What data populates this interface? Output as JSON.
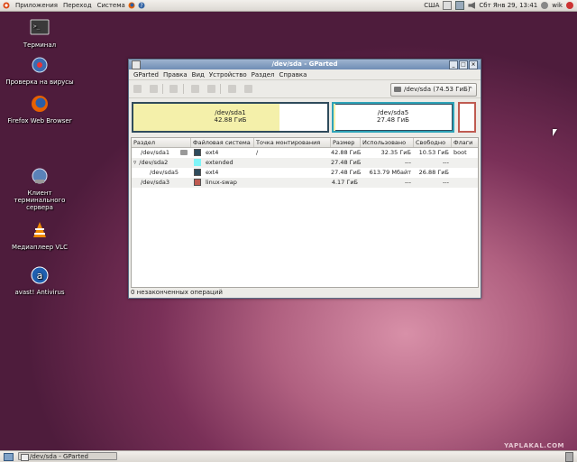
{
  "top_panel": {
    "menus": [
      "Приложения",
      "Переход",
      "Система"
    ],
    "keyboard_layout": "США",
    "clock": "Сбт Янв 29, 13:41",
    "user": "wik"
  },
  "desktop_icons": [
    {
      "label": "Терминал",
      "icon": "terminal-icon"
    },
    {
      "label": "Проверка на вирусы",
      "icon": "virus-scan-icon"
    },
    {
      "label": "Firefox Web Browser",
      "icon": "firefox-icon"
    },
    {
      "label": "Клиент терминального сервера",
      "icon": "remote-client-icon"
    },
    {
      "label": "Медиаплеер VLC",
      "icon": "vlc-icon"
    },
    {
      "label": "avast! Antivirus",
      "icon": "avast-icon"
    }
  ],
  "window": {
    "title": "/dev/sda - GParted",
    "menu": [
      "GParted",
      "Правка",
      "Вид",
      "Устройство",
      "Раздел",
      "Справка"
    ],
    "device": "/dev/sda  (74.53 ГиБ)",
    "graph": {
      "sda1": {
        "name": "/dev/sda1",
        "size": "42.88 ГиБ"
      },
      "sda5": {
        "name": "/dev/sda5",
        "size": "27.48 ГиБ"
      }
    },
    "columns": [
      "Раздел",
      "Файловая система",
      "Точка монтирования",
      "Размер",
      "Использовано",
      "Свободно",
      "Флаги"
    ],
    "rows": [
      {
        "partition": "/dev/sda1",
        "fs": "ext4",
        "mount": "/",
        "size": "42.88 ГиБ",
        "used": "32.35 ГиБ",
        "free": "10.53 ГиБ",
        "flags": "boot",
        "color": "#2f4b5c"
      },
      {
        "partition": "/dev/sda2",
        "fs": "extended",
        "mount": "",
        "size": "27.48 ГиБ",
        "used": "---",
        "free": "---",
        "flags": "",
        "color": "#7ff5f8"
      },
      {
        "partition": "/dev/sda5",
        "fs": "ext4",
        "mount": "",
        "size": "27.48 ГиБ",
        "used": "613.79 Мбайт",
        "free": "26.88 ГиБ",
        "flags": "",
        "color": "#2f4b5c"
      },
      {
        "partition": "/dev/sda3",
        "fs": "linux-swap",
        "mount": "",
        "size": "4.17 ГиБ",
        "used": "---",
        "free": "---",
        "flags": "",
        "color": "#bf5b51"
      }
    ],
    "status": "0 незаконченных операций"
  },
  "taskbar": {
    "task_label": "/dev/sda - GParted"
  },
  "watermark": "YAPLAKAL.COM"
}
